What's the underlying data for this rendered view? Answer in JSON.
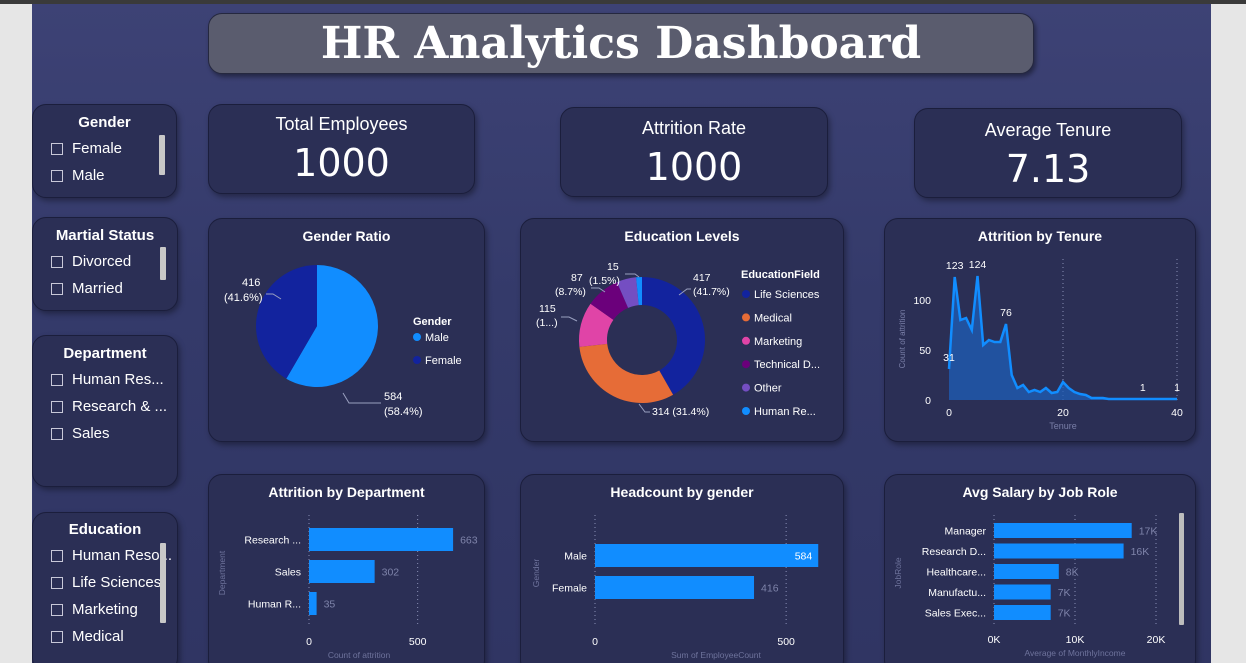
{
  "title": "HR Analytics Dashboard",
  "slicers": {
    "gender": {
      "title": "Gender",
      "options": [
        "Female",
        "Male"
      ]
    },
    "marital": {
      "title": "Martial Status",
      "options": [
        "Divorced",
        "Married"
      ]
    },
    "department": {
      "title": "Department",
      "options": [
        "Human Res...",
        "Research & ...",
        "Sales"
      ]
    },
    "education": {
      "title": "Education",
      "options": [
        "Human Reso...",
        "Life Sciences",
        "Marketing",
        "Medical"
      ]
    }
  },
  "kpis": {
    "total_employees": {
      "label": "Total Employees",
      "value": "1000"
    },
    "attrition_rate": {
      "label": "Attrition Rate",
      "value": "1000"
    },
    "average_tenure": {
      "label": "Average Tenure",
      "value": "7.13"
    }
  },
  "colors": {
    "male": "#118dff",
    "female": "#12239e",
    "accent": "#118dff"
  },
  "chart_data": [
    {
      "id": "gender_ratio",
      "type": "pie",
      "title": "Gender Ratio",
      "legend_title": "Gender",
      "legend_position": "right",
      "slices": [
        {
          "name": "Male",
          "value": 584,
          "label": "584",
          "pct": "(58.4%)",
          "color": "#118dff"
        },
        {
          "name": "Female",
          "value": 416,
          "label": "416",
          "pct": "(41.6%)",
          "color": "#12239e"
        }
      ]
    },
    {
      "id": "education_levels",
      "type": "pie",
      "title": "Education Levels",
      "legend_title": "EducationField",
      "legend_position": "right",
      "slices": [
        {
          "name": "Life Sciences",
          "legend": "Life Sciences",
          "value": 417,
          "label": "417 (41.7%)",
          "color": "#12239e"
        },
        {
          "name": "Medical",
          "legend": "Medical",
          "value": 314,
          "label": "314 (31.4%)",
          "color": "#e66c37"
        },
        {
          "name": "Marketing",
          "legend": "Marketing",
          "value": 115,
          "label": "115 (1...)",
          "color": "#e044a7"
        },
        {
          "name": "Technical Degree",
          "legend": "Technical D...",
          "value": 87,
          "label": "87 (8.7%)",
          "color": "#6b007b"
        },
        {
          "name": "Other",
          "legend": "Other",
          "value": 50,
          "label": "",
          "color": "#744ec2"
        },
        {
          "name": "Human Resources",
          "legend": "Human Re...",
          "value": 15,
          "label": "15 (1.5%)",
          "color": "#118dff"
        }
      ]
    },
    {
      "id": "attrition_by_tenure",
      "type": "area",
      "title": "Attrition by Tenure",
      "xlabel": "Tenure",
      "ylabel": "Count of attrition",
      "xlim": [
        0,
        40
      ],
      "ylim": [
        0,
        130
      ],
      "xticks": [
        "0",
        "20",
        "40"
      ],
      "yticks": [
        "0",
        "50",
        "100"
      ],
      "x": [
        0,
        1,
        2,
        3,
        4,
        5,
        6,
        7,
        8,
        9,
        10,
        11,
        12,
        13,
        14,
        15,
        16,
        17,
        18,
        19,
        20,
        21,
        22,
        23,
        24,
        25,
        26,
        27,
        28,
        29,
        30,
        31,
        32,
        33,
        34,
        35,
        36,
        37,
        38,
        39,
        40
      ],
      "y": [
        31,
        123,
        80,
        82,
        70,
        124,
        55,
        60,
        58,
        58,
        76,
        25,
        12,
        15,
        8,
        10,
        8,
        12,
        7,
        8,
        18,
        12,
        8,
        6,
        5,
        2,
        2,
        2,
        1,
        1,
        1,
        1,
        1,
        1,
        1,
        1,
        1,
        1,
        1,
        1,
        1
      ],
      "data_labels": [
        {
          "x": 0,
          "y": 31,
          "text": "31"
        },
        {
          "x": 1,
          "y": 123,
          "text": "123"
        },
        {
          "x": 5,
          "y": 124,
          "text": "124"
        },
        {
          "x": 10,
          "y": 76,
          "text": "76"
        },
        {
          "x": 34,
          "y": 1,
          "text": "1"
        },
        {
          "x": 40,
          "y": 1,
          "text": "1"
        }
      ],
      "grid": true
    },
    {
      "id": "attrition_by_department",
      "type": "bar",
      "orientation": "horizontal",
      "title": "Attrition by Department",
      "xlabel": "Count of attrition",
      "ylabel": "Department",
      "categories": [
        "Research ...",
        "Sales",
        "Human R..."
      ],
      "values": [
        663,
        302,
        35
      ],
      "xticks": [
        "0",
        "500"
      ],
      "xlim": [
        0,
        750
      ],
      "grid": true
    },
    {
      "id": "headcount_by_gender",
      "type": "bar",
      "orientation": "horizontal",
      "title": "Headcount by gender",
      "xlabel": "Sum of EmployeeCount",
      "ylabel": "Gender",
      "categories": [
        "Male",
        "Female"
      ],
      "values": [
        584,
        416
      ],
      "xticks": [
        "0",
        "500"
      ],
      "xlim": [
        0,
        620
      ],
      "grid": true
    },
    {
      "id": "avg_salary_by_job_role",
      "type": "bar",
      "orientation": "horizontal",
      "title": "Avg Salary by Job Role",
      "xlabel": "Average of MonthlyIncome",
      "ylabel": "JobRole",
      "categories": [
        "Manager",
        "Research D...",
        "Healthcare...",
        "Manufactu...",
        "Sales Exec..."
      ],
      "values": [
        17000,
        16000,
        8000,
        7000,
        7000
      ],
      "value_labels": [
        "17K",
        "16K",
        "8K",
        "7K",
        "7K"
      ],
      "xticks": [
        "0K",
        "10K",
        "20K"
      ],
      "xlim": [
        0,
        20000
      ],
      "grid": true
    }
  ]
}
